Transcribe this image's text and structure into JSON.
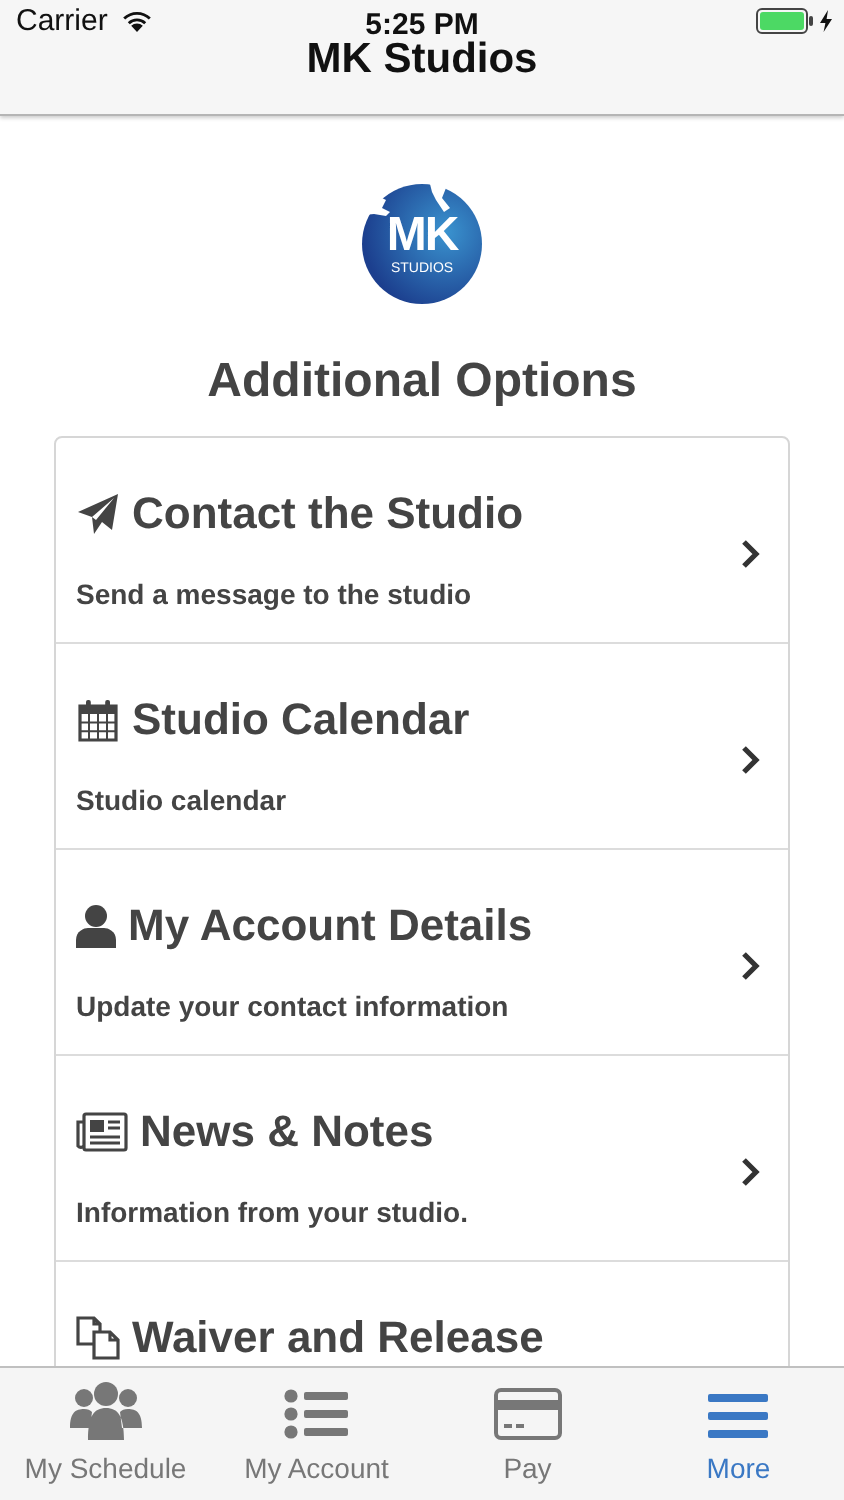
{
  "status_bar": {
    "carrier": "Carrier",
    "time": "5:25 PM"
  },
  "nav_bar": {
    "title": "MK Studios"
  },
  "logo": {
    "initials": "MK",
    "subtitle": "STUDIOS"
  },
  "heading": "Additional Options",
  "options": [
    {
      "kind": "plane",
      "title": "Contact the Studio",
      "subtitle": "Send a message to the studio"
    },
    {
      "kind": "calendar",
      "title": "Studio Calendar",
      "subtitle": "Studio calendar"
    },
    {
      "kind": "user",
      "title": "My Account Details",
      "subtitle": "Update your contact information"
    },
    {
      "kind": "news",
      "title": "News & Notes",
      "subtitle": "Information from your studio."
    },
    {
      "kind": "copy",
      "title": "Waiver and Release"
    }
  ],
  "tabs": [
    {
      "kind": "group",
      "label": "My Schedule",
      "selected": false
    },
    {
      "kind": "list",
      "label": "My Account",
      "selected": false
    },
    {
      "kind": "card",
      "label": "Pay",
      "selected": false
    },
    {
      "kind": "menu",
      "label": "More",
      "selected": true
    }
  ]
}
